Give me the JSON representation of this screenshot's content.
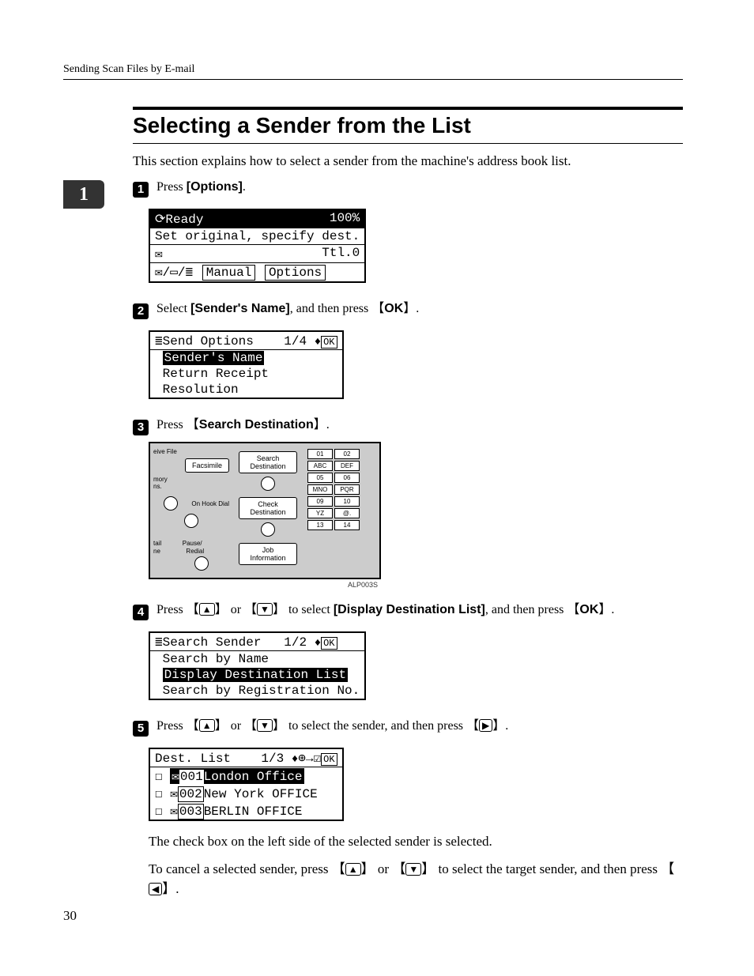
{
  "header": {
    "breadcrumb": "Sending Scan Files by E-mail"
  },
  "chapter_tab": "1",
  "page_number": "30",
  "title": "Selecting a Sender from the List",
  "intro": "This section explains how to select a sender from the machine's address book list.",
  "steps": {
    "s1": {
      "num": "1",
      "pre": "Press ",
      "bold": "[Options]",
      "post": "."
    },
    "s2": {
      "num": "2",
      "pre": "Select ",
      "bold": "[Sender's Name]",
      "mid": ", and then press ",
      "key": "OK",
      "post": "."
    },
    "s3": {
      "num": "3",
      "pre": "Press ",
      "key": "Search Destination",
      "post": "."
    },
    "s4": {
      "num": "4",
      "pre": "Press ",
      "arr1": "▲",
      "or": " or ",
      "arr2": "▼",
      "mid": " to select ",
      "bold": "[Display Destination List]",
      "mid2": ", and then press ",
      "key": "OK",
      "post": "."
    },
    "s5": {
      "num": "5",
      "pre": "Press ",
      "arr1": "▲",
      "or": " or ",
      "arr2": "▼",
      "mid": " to select the sender, and then press ",
      "arr3": "▶",
      "post": "."
    }
  },
  "lcd1": {
    "row1_left": "Ready",
    "row1_right": "100%",
    "row2": "Set original, specify dest.",
    "row3_right": "Ttl.0",
    "row4_btn1": "Manual",
    "row4_btn2": "Options"
  },
  "lcd2": {
    "title": "Send Options",
    "page": "1/4",
    "ok": "OK",
    "item1": "Sender's Name",
    "item2": "Return Receipt",
    "item3": "Resolution"
  },
  "panel": {
    "left": {
      "a": "eive File",
      "b": "Facsimile",
      "c": "mory",
      "d": "ns.",
      "e": "On Hook Dial",
      "f": "tail",
      "g": "ne",
      "h": "Pause/",
      "i": "Redial"
    },
    "mid": {
      "a": "Search\nDestination",
      "b": "Check\nDestination",
      "c": "Job\nInformation"
    },
    "keys": [
      "01",
      "02",
      "ABC",
      "DEF",
      "05",
      "06",
      "MNO",
      "PQR",
      "09",
      "10",
      "YZ",
      "@.",
      "13",
      "14"
    ],
    "caption": "ALP003S"
  },
  "lcd3": {
    "title": "Search Sender",
    "page": "1/2",
    "ok": "OK",
    "item1": "Search by Name",
    "item2": "Display Destination List",
    "item3": "Search by Registration No."
  },
  "lcd4": {
    "title": "Dest. List",
    "page": "1/3",
    "ok": "OK",
    "r1_id": "001",
    "r1_name": "London Office",
    "r2_id": "002",
    "r2_name": "New York OFFICE",
    "r3_id": "003",
    "r3_name": "BERLIN OFFICE"
  },
  "footer_text": {
    "p1": "The check box on the left side of the selected sender is selected.",
    "p2a": "To cancel a selected sender, press ",
    "p2_arr1": "▲",
    "p2_or": " or ",
    "p2_arr2": "▼",
    "p2b": " to select the target sender, and then press ",
    "p2_arr3": "◀",
    "p2c": "."
  }
}
